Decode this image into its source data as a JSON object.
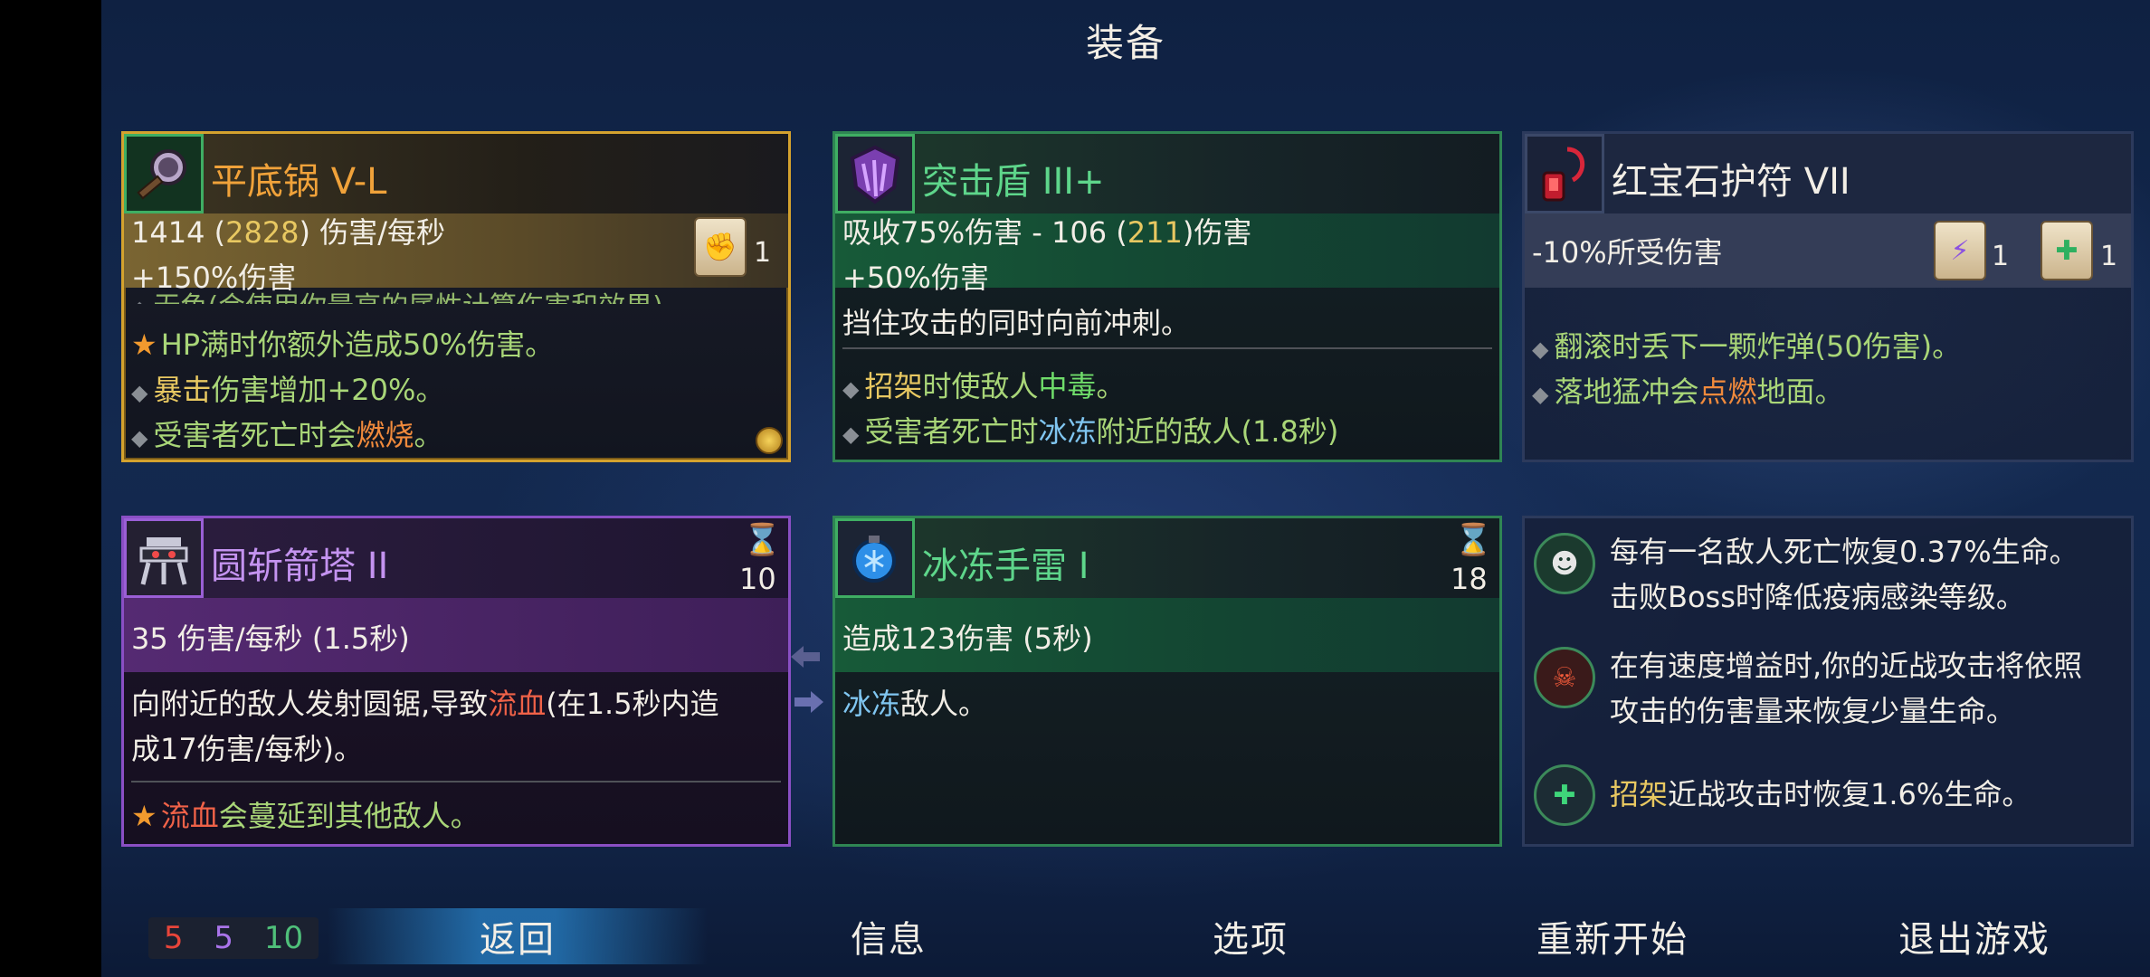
{
  "screen_title": "装备",
  "cards": {
    "pan": {
      "name": "平底锅 V-L",
      "stat1_main": "1414 (",
      "stat1_boost": "2828",
      "stat1_tail": ") 伤害/每秒",
      "stat2": "+150%伤害",
      "scroll_count": "1",
      "cut_line": "无色(会使用你最高的属性计算伤害和效果)",
      "affix1_hl": "HP满时你额外造成50%伤害。",
      "affix2_a": "暴击",
      "affix2_b": "伤害增加+20%。",
      "affix3_a": "受害者死亡时会",
      "affix3_b": "燃烧",
      "affix3_c": "。"
    },
    "shield": {
      "name": "突击盾 III+",
      "stat1_main": "吸收75%伤害 - 106 (",
      "stat1_boost": "211",
      "stat1_tail": ")伤害",
      "stat2": "+50%伤害",
      "desc": "挡住攻击的同时向前冲刺。",
      "affix1_a": "招架",
      "affix1_b": "时使敌人",
      "affix1_c": "中毒",
      "affix1_d": "。",
      "affix2_a": "受害者死亡时",
      "affix2_b": "冰冻",
      "affix2_c": "附近的敌人(1.8秒)"
    },
    "amulet": {
      "name": "红宝石护符 VII",
      "stat1": "-10%所受伤害",
      "scroll1_count": "1",
      "scroll2_count": "1",
      "affix1": "翻滚时丢下一颗炸弹(50伤害)。",
      "affix2_a": "落地猛冲会",
      "affix2_b": "点燃",
      "affix2_c": "地面。"
    },
    "tower": {
      "name": "圆斩箭塔 II",
      "cooldown": "10",
      "stat1": "35 伤害/每秒 (1.5秒)",
      "desc1_a": "向附近的敌人发射圆锯,导致",
      "desc1_b": "流血",
      "desc1_c": "(在1.5秒内造",
      "desc2": "成17伤害/每秒)。",
      "affix1_a": "流血",
      "affix1_b": "会蔓延到其他敌人。"
    },
    "grenade": {
      "name": "冰冻手雷 I",
      "cooldown": "18",
      "stat1": "造成123伤害 (5秒)",
      "desc_a": "冰冻",
      "desc_b": "敌人。"
    },
    "mutations": {
      "m1_line1": "每有一名敌人死亡恢复0.37%生命。",
      "m1_line2": "击败Boss时降低疫病感染等级。",
      "m2_line1": "在有速度增益时,你的近战攻击将依照",
      "m2_line2": "攻击的伤害量来恢复少量生命。",
      "m3_a": "招架",
      "m3_b": "近战攻击时恢复1.6%生命。"
    }
  },
  "scrolls": {
    "red": "5",
    "purple": "5",
    "green": "10"
  },
  "menu": {
    "back": "返回",
    "info": "信息",
    "options": "选项",
    "restart": "重新开始",
    "quit": "退出游戏"
  },
  "colors": {
    "gold_border": "#d4a22e",
    "green_border": "#2f8553",
    "purple_border": "#8a4fc4",
    "brutality_red": "#e8453a",
    "tactics_purple": "#a974ea",
    "survival_green": "#4fc07a"
  },
  "icons": {
    "pan": "frying-pan-icon",
    "shield": "assault-shield-icon",
    "amulet": "ruby-amulet-icon",
    "tower": "saw-tower-icon",
    "grenade": "ice-grenade-icon",
    "hourglass": "hourglass-icon",
    "scroll": "scroll-icon"
  }
}
